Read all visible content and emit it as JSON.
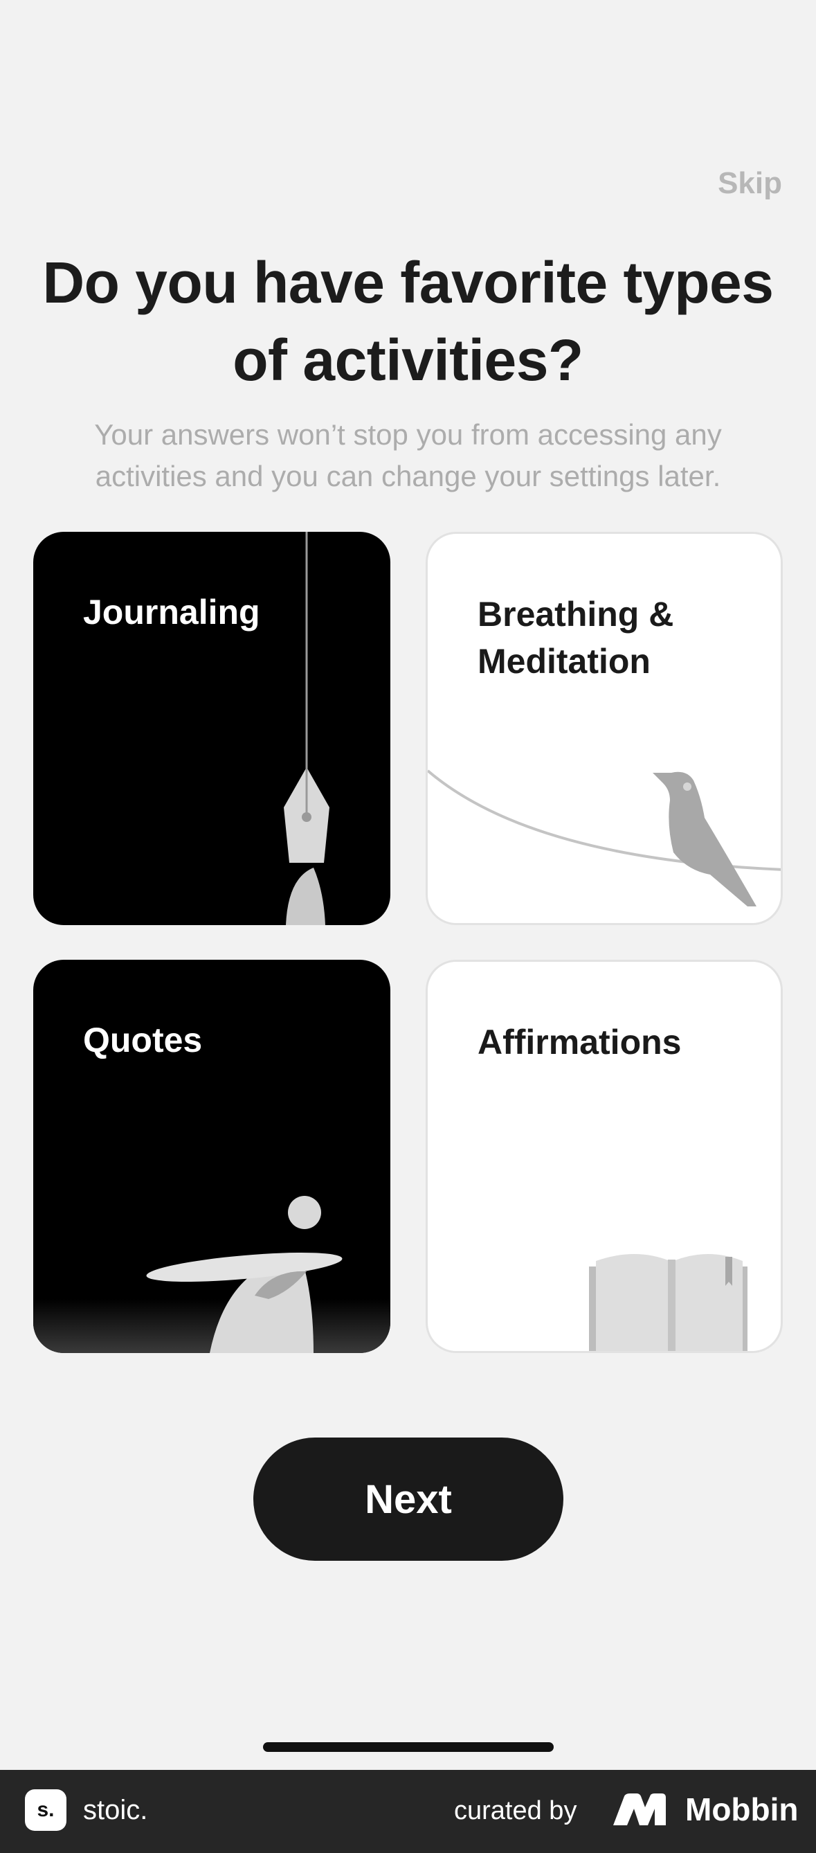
{
  "header": {
    "skip_label": "Skip"
  },
  "main": {
    "title": "Do you have favorite types of activities?",
    "subtitle": "Your answers won’t stop you from accessing any activities and you can change your settings later.",
    "cards": [
      {
        "label": "Journaling",
        "theme": "dark",
        "icon": "pen-nib-icon"
      },
      {
        "label": "Breathing & Meditation",
        "theme": "light",
        "icon": "bird-icon"
      },
      {
        "label": "Quotes",
        "theme": "dark",
        "icon": "thinker-icon"
      },
      {
        "label": "Affirmations",
        "theme": "light",
        "icon": "book-icon"
      }
    ],
    "next_label": "Next"
  },
  "footer": {
    "brand_logo_text": "s.",
    "brand_name": "stoic.",
    "curated_label": "curated by",
    "curator_name": "Mobbin"
  },
  "colors": {
    "background": "#f2f2f2",
    "dark_card": "#000000",
    "light_card": "#ffffff",
    "button": "#1a1a1a",
    "muted_text": "#acacac",
    "illustration_gray": "#c4c4c4"
  }
}
